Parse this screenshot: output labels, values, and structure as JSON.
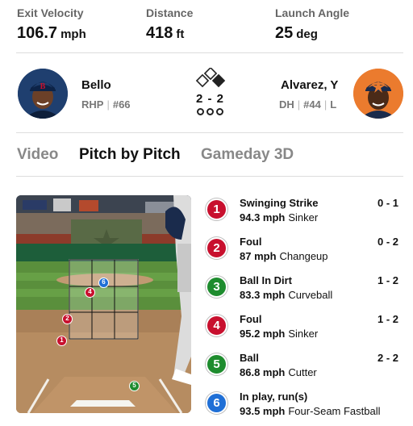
{
  "stats": [
    {
      "label": "Exit Velocity",
      "value": "106.7",
      "unit": "mph"
    },
    {
      "label": "Distance",
      "value": "418",
      "unit": "ft"
    },
    {
      "label": "Launch Angle",
      "value": "25",
      "unit": "deg"
    }
  ],
  "matchup": {
    "pitcher": {
      "name": "Bello",
      "position": "RHP",
      "number": "#66",
      "team_logo": "red-sox-logo"
    },
    "batter": {
      "name": "Alvarez, Y",
      "position": "DH",
      "number": "#44",
      "hand": "L",
      "team_logo": "astros-logo"
    },
    "count": "2 - 2",
    "bases": {
      "first": false,
      "second": false,
      "third": true
    },
    "outs": 0
  },
  "tabs": [
    {
      "label": "Video",
      "active": false
    },
    {
      "label": "Pitch by Pitch",
      "active": true
    },
    {
      "label": "Gameday 3D",
      "active": false
    }
  ],
  "colors": {
    "strike": "#c8102e",
    "ball": "#1e8c2e",
    "in_play": "#1f6fd6"
  },
  "pitches": [
    {
      "num": "1",
      "result": "Swinging Strike",
      "speed": "94.3 mph",
      "type": "Sinker",
      "count": "0 - 1",
      "color": "#c8102e"
    },
    {
      "num": "2",
      "result": "Foul",
      "speed": "87 mph",
      "type": "Changeup",
      "count": "0 - 2",
      "color": "#c8102e"
    },
    {
      "num": "3",
      "result": "Ball In Dirt",
      "speed": "83.3 mph",
      "type": "Curveball",
      "count": "1 - 2",
      "color": "#1e8c2e"
    },
    {
      "num": "4",
      "result": "Foul",
      "speed": "95.2 mph",
      "type": "Sinker",
      "count": "1 - 2",
      "color": "#c8102e"
    },
    {
      "num": "5",
      "result": "Ball",
      "speed": "86.8 mph",
      "type": "Cutter",
      "count": "2 - 2",
      "color": "#1e8c2e"
    },
    {
      "num": "6",
      "result": "In play, run(s)",
      "speed": "93.5 mph",
      "type": "Four-Seam Fastball",
      "count": "",
      "color": "#1f6fd6"
    }
  ]
}
